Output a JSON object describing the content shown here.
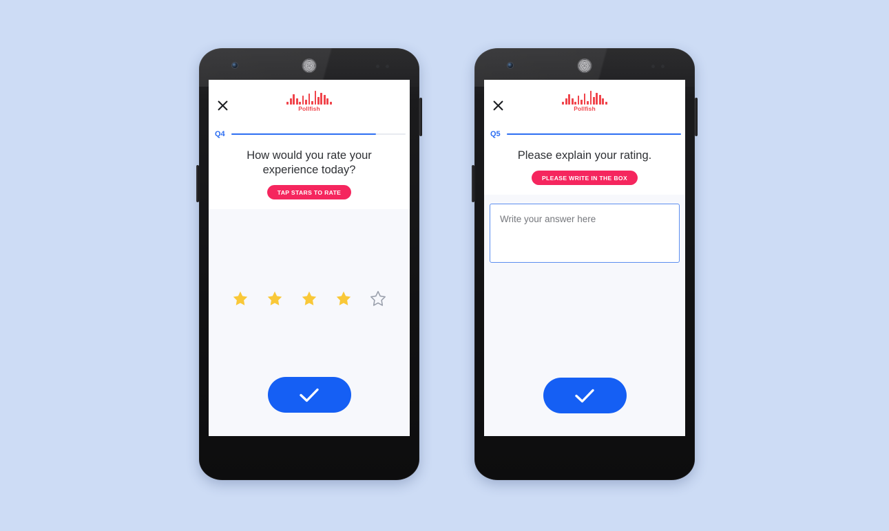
{
  "page": {
    "background_color": "#cddcf5",
    "accent_blue": "#155ff4",
    "progress_blue": "#2c6ef2",
    "badge_pink": "#f5265e",
    "brand_red": "#f0444b",
    "star_filled_color": "#f9c838",
    "star_empty_color": "#9aa0ac"
  },
  "phones": [
    {
      "id": "phone-1",
      "header": {
        "close_icon": "close-icon",
        "brand_name": "Pollfish",
        "brand_mark": "waveform-icon"
      },
      "progress": {
        "label": "Q4",
        "percent": 83
      },
      "question": {
        "text": "How would you rate your experience today?",
        "hint_badge": "TAP STARS TO RATE"
      },
      "rating": {
        "type": "stars",
        "max": 5,
        "value": 4,
        "stars": [
          "filled",
          "filled",
          "filled",
          "filled",
          "empty"
        ]
      },
      "submit": {
        "icon": "check-icon",
        "label": ""
      }
    },
    {
      "id": "phone-2",
      "header": {
        "close_icon": "close-icon",
        "brand_name": "Pollfish",
        "brand_mark": "waveform-icon"
      },
      "progress": {
        "label": "Q5",
        "percent": 100
      },
      "question": {
        "text": "Please explain your rating.",
        "hint_badge": "PLEASE WRITE IN THE BOX"
      },
      "answer": {
        "value": "",
        "placeholder": "Write your answer here"
      },
      "submit": {
        "icon": "check-icon",
        "label": ""
      }
    }
  ]
}
